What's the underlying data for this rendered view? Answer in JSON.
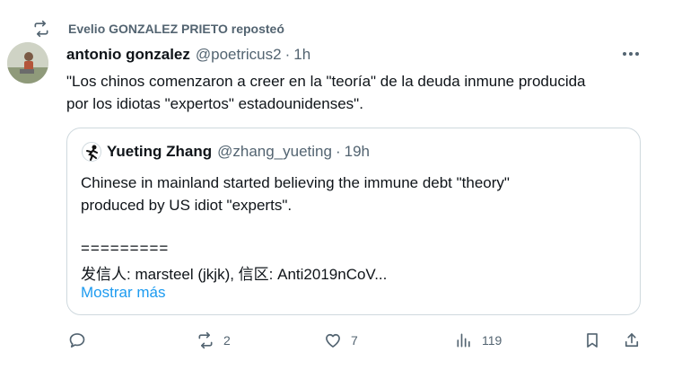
{
  "repost": {
    "label": "Evelio GONZALEZ PRIETO reposteó"
  },
  "tweet": {
    "name": "antonio gonzalez",
    "handle": "@poetricus2",
    "separator": "·",
    "time": "1h",
    "text": "\"Los chinos comenzaron a creer en la \"teoría\" de la deuda inmune producida\npor los idiotas \"expertos\" estadounidenses\"."
  },
  "quote": {
    "name": "Yueting Zhang",
    "handle": "@zhang_yueting",
    "separator": "·",
    "time": "19h",
    "text": "Chinese in mainland started believing the immune debt \"theory\"\nproduced by US idiot \"experts\".",
    "divider_line": "=========",
    "sender_line": "发信人: marsteel (jkjk), 信区: Anti2019nCoV...",
    "show_more": "Mostrar más"
  },
  "actions": {
    "reply_count": "",
    "repost_count": "2",
    "like_count": "7",
    "views_count": "119"
  },
  "icons": [
    "repost-icon",
    "more-icon",
    "reply-icon",
    "like-icon",
    "views-icon",
    "bookmark-icon",
    "share-icon"
  ]
}
